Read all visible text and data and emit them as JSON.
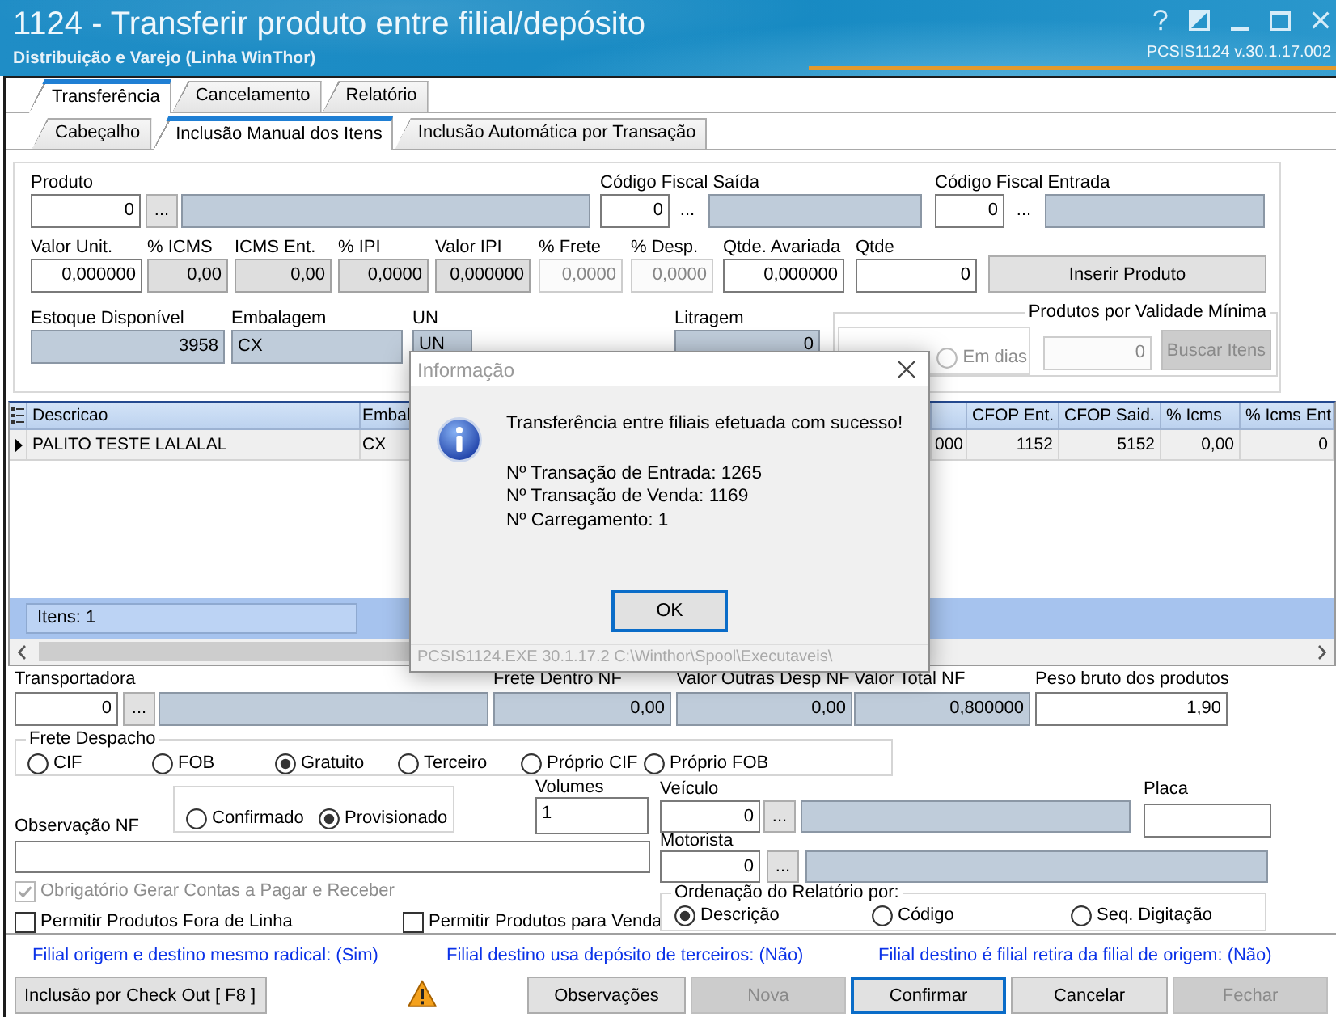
{
  "window": {
    "title": "1124 - Transferir produto entre filial/depósito",
    "subtitle": "Distribuição e Varejo (Linha WinThor)",
    "version": "PCSIS1124 v.30.1.17.002"
  },
  "tabs": [
    {
      "label": "Transferência",
      "selected": true
    },
    {
      "label": "Cancelamento",
      "selected": false
    },
    {
      "label": "Relatório",
      "selected": false
    }
  ],
  "subtabs": [
    {
      "label": "Cabeçalho",
      "selected": false
    },
    {
      "label": "Inclusão Manual dos Itens",
      "selected": true
    },
    {
      "label": "Inclusão Automática por Transação",
      "selected": false
    }
  ],
  "item_form": {
    "product_fields": [
      {
        "label": "Produto",
        "controls": [
          {
            "kind": "input",
            "value": "0"
          },
          {
            "kind": "lookup",
            "label": "..."
          },
          {
            "kind": "readonly"
          }
        ]
      },
      {
        "label": "Código Fiscal Saída",
        "controls": [
          {
            "kind": "input",
            "value": "0"
          },
          {
            "kind": "flat_lookup",
            "label": "..."
          },
          {
            "kind": "readonly"
          }
        ]
      },
      {
        "label": "Código Fiscal Entrada",
        "controls": [
          {
            "kind": "input",
            "value": "0"
          },
          {
            "kind": "flat_lookup",
            "label": "..."
          },
          {
            "kind": "readonly"
          }
        ]
      }
    ],
    "value_fields": [
      {
        "label": "Valor Unit.",
        "controls": [
          {
            "kind": "input",
            "value": "0,000000"
          }
        ]
      },
      {
        "label": "% ICMS",
        "controls": [
          {
            "kind": "locked",
            "value": "0,00"
          }
        ]
      },
      {
        "label": "ICMS Ent.",
        "controls": [
          {
            "kind": "locked",
            "value": "0,00"
          }
        ]
      },
      {
        "label": "% IPI",
        "controls": [
          {
            "kind": "locked",
            "value": "0,0000"
          }
        ]
      },
      {
        "label": "Valor IPI",
        "controls": [
          {
            "kind": "locked",
            "value": "0,000000"
          }
        ]
      },
      {
        "label": "% Frete",
        "controls": [
          {
            "kind": "disabled",
            "value": "0,0000"
          }
        ]
      },
      {
        "label": "% Desp.",
        "controls": [
          {
            "kind": "disabled",
            "value": "0,0000"
          }
        ]
      },
      {
        "label": "Qtde. Avariada",
        "controls": [
          {
            "kind": "input",
            "value": "0,000000"
          }
        ]
      },
      {
        "label": "Qtde",
        "controls": [
          {
            "kind": "input",
            "value": "0"
          }
        ]
      },
      {
        "controls": [
          {
            "kind": "button",
            "label": "Inserir Produto",
            "disabled": false
          }
        ]
      }
    ],
    "stock_fields": [
      {
        "label": "Estoque Disponível",
        "controls": [
          {
            "kind": "readonly",
            "value": "3958"
          }
        ]
      },
      {
        "label": "Embalagem",
        "controls": [
          {
            "kind": "readonly",
            "value": "CX"
          }
        ]
      },
      {
        "label": "UN",
        "controls": [
          {
            "kind": "readonly",
            "value": "UN"
          }
        ]
      },
      {
        "label": "Litragem",
        "controls": [
          {
            "kind": "readonly",
            "value": "0"
          }
        ]
      }
    ],
    "validity": {
      "title": "Produtos por Validade Mínima",
      "options": [
        {
          "label": "Em dias",
          "selected": false,
          "disabled": true
        }
      ],
      "field": {
        "kind": "disabled",
        "value": "0"
      },
      "button": {
        "label": "Buscar Itens",
        "disabled": true
      }
    }
  },
  "grid": {
    "columns": [
      "Descricao",
      "Embal",
      "",
      "CFOP Ent.",
      "CFOP Said.",
      "% Icms",
      "% Icms Ent"
    ],
    "rows": [
      {
        "selected": true,
        "cells": [
          "PALITO TESTE LALALAL",
          "CX",
          "000",
          "1152",
          "5152",
          "0,00",
          "0"
        ]
      }
    ],
    "footer": "Itens: 1"
  },
  "shipping": {
    "fields": [
      {
        "label": "Transportadora",
        "controls": [
          {
            "kind": "input",
            "value": "0"
          },
          {
            "kind": "lookup",
            "label": "..."
          },
          {
            "kind": "readonly"
          }
        ]
      },
      {
        "label": "Frete Dentro NF",
        "controls": [
          {
            "kind": "readonly",
            "value": "0,00"
          }
        ]
      },
      {
        "label": "Valor Outras Desp NF",
        "controls": [
          {
            "kind": "readonly",
            "value": "0,00"
          }
        ]
      },
      {
        "label": "Valor Total NF",
        "controls": [
          {
            "kind": "readonly",
            "value": "0,800000"
          }
        ]
      },
      {
        "label": "Peso bruto dos produtos",
        "controls": [
          {
            "kind": "input",
            "value": "1,90"
          }
        ]
      }
    ],
    "freight": {
      "title": "Frete Despacho",
      "options": [
        {
          "label": "CIF",
          "selected": false
        },
        {
          "label": "FOB",
          "selected": false
        },
        {
          "label": "Gratuito",
          "selected": true
        },
        {
          "label": "Terceiro",
          "selected": false
        },
        {
          "label": "Próprio CIF",
          "selected": false
        },
        {
          "label": "Próprio FOB",
          "selected": false
        }
      ]
    },
    "status_options": [
      {
        "label": "Confirmado",
        "selected": false
      },
      {
        "label": "Provisionado",
        "selected": true
      }
    ],
    "volumes": {
      "label": "Volumes",
      "controls": [
        {
          "kind": "input",
          "value": "1"
        }
      ]
    },
    "notes": {
      "label": "Observação NF",
      "controls": [
        {
          "kind": "input"
        }
      ]
    },
    "vehicle": {
      "label": "Veículo",
      "controls": [
        {
          "kind": "input",
          "value": "0"
        },
        {
          "kind": "lookup",
          "label": "..."
        },
        {
          "kind": "readonly"
        }
      ]
    },
    "plate": {
      "label": "Placa",
      "controls": [
        {
          "kind": "input"
        }
      ]
    },
    "driver": {
      "label": "Motorista",
      "controls": [
        {
          "kind": "input",
          "value": "0"
        },
        {
          "kind": "lookup",
          "label": "..."
        },
        {
          "kind": "readonly"
        }
      ]
    },
    "checkboxes": [
      {
        "label": "Obrigatório Gerar Contas a Pagar e Receber",
        "checked": true,
        "disabled": true
      },
      {
        "label": "Permitir Produtos Fora de Linha",
        "checked": false,
        "disabled": false
      },
      {
        "label": "Permitir Produtos para Venda",
        "checked": false,
        "disabled": false
      }
    ],
    "report_order": {
      "title": "Ordenação do Relatório por:",
      "options": [
        {
          "label": "Descrição",
          "selected": true
        },
        {
          "label": "Código",
          "selected": false
        },
        {
          "label": "Seq. Digitação",
          "selected": false
        }
      ]
    }
  },
  "notices": [
    "Filial origem e destino mesmo radical: (Sim)",
    "Filial destino usa depósito de terceiros: (Não)",
    "Filial destino é filial retira da filial de origem: (Não)"
  ],
  "buttons": [
    {
      "label": "Inclusão por Check Out [ F8 ]",
      "disabled": false,
      "focused": false
    },
    {
      "label": "Observações",
      "disabled": false,
      "focused": false
    },
    {
      "label": "Nova",
      "disabled": true,
      "focused": false
    },
    {
      "label": "Confirmar",
      "disabled": false,
      "focused": true
    },
    {
      "label": "Cancelar",
      "disabled": false,
      "focused": false
    },
    {
      "label": "Fechar",
      "disabled": true,
      "focused": false
    }
  ],
  "dialog": {
    "title": "Informação",
    "message": [
      "Transferência entre filiais efetuada com sucesso!",
      "Nº Transação de Entrada: 1265",
      "Nº Transação de Venda: 1169",
      "Nº Carregamento: 1"
    ],
    "button": {
      "label": "OK",
      "focused": true
    },
    "footer": "PCSIS1124.EXE 30.1.17.2 C:\\Winthor\\Spool\\Executaveis\\"
  }
}
